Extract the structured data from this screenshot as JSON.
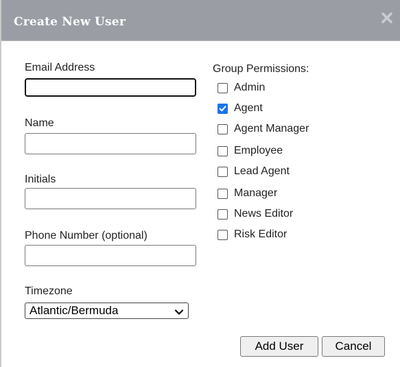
{
  "dialog": {
    "title": "Create New User",
    "close_icon": "close-icon"
  },
  "form": {
    "email_label": "Email Address",
    "email_value": "",
    "name_label": "Name",
    "name_value": "",
    "initials_label": "Initials",
    "initials_value": "",
    "phone_label": "Phone Number (optional)",
    "phone_value": "",
    "timezone_label": "Timezone",
    "timezone_value": "Atlantic/Bermuda"
  },
  "permissions": {
    "label": "Group Permissions:",
    "items": [
      {
        "label": "Admin",
        "checked": false
      },
      {
        "label": "Agent",
        "checked": true
      },
      {
        "label": "Agent Manager",
        "checked": false
      },
      {
        "label": "Employee",
        "checked": false
      },
      {
        "label": "Lead Agent",
        "checked": false
      },
      {
        "label": "Manager",
        "checked": false
      },
      {
        "label": "News Editor",
        "checked": false
      },
      {
        "label": "Risk Editor",
        "checked": false
      }
    ]
  },
  "buttons": {
    "add_user": "Add User",
    "cancel": "Cancel"
  },
  "colors": {
    "titlebar": "#9a9ea4",
    "checkbox_checked": "#1a73e8"
  }
}
